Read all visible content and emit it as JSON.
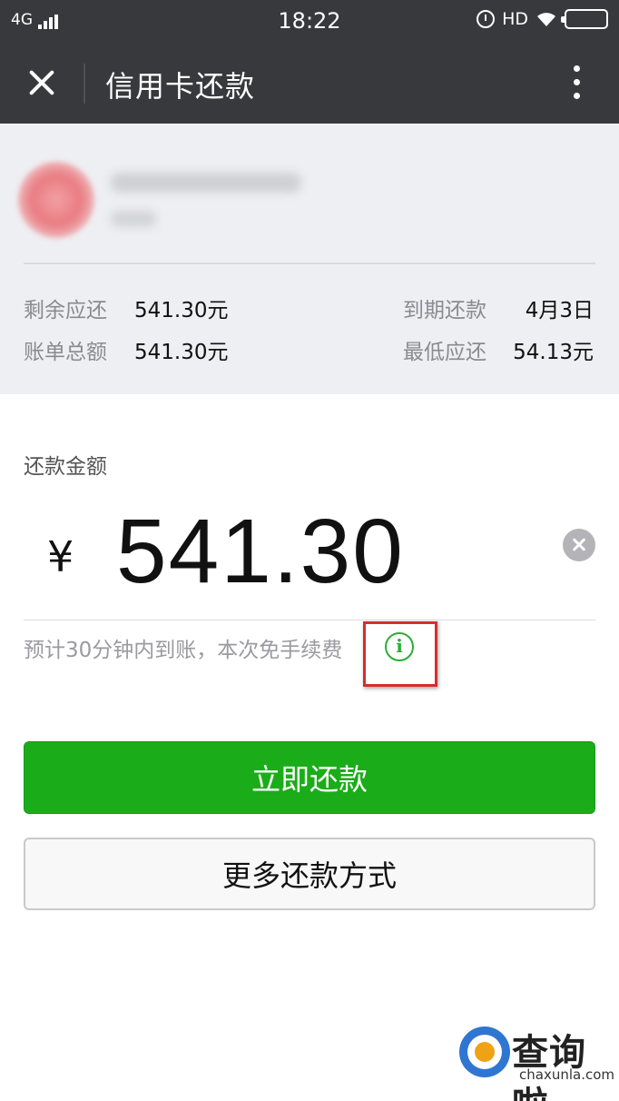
{
  "status_bar": {
    "network": "4G",
    "time": "18:22",
    "hd": "HD"
  },
  "nav": {
    "title": "信用卡还款"
  },
  "summary": {
    "remaining_label": "剩余应还",
    "remaining_value": "541.30元",
    "due_label": "到期还款",
    "due_value": "4月3日",
    "bill_total_label": "账单总额",
    "bill_total_value": "541.30元",
    "min_label": "最低应还",
    "min_value": "54.13元"
  },
  "payment": {
    "amount_label": "还款金额",
    "currency_symbol": "¥",
    "amount": "541.30",
    "hint": "预计30分钟内到账，本次免手续费",
    "info_glyph": "i",
    "pay_button": "立即还款",
    "more_ways_button": "更多还款方式"
  },
  "watermark": {
    "title": "查询啦",
    "subtitle": "chaxunla.com"
  },
  "colors": {
    "header_bg": "#37393d",
    "summary_bg": "#eeeff3",
    "primary_green": "#1aad19",
    "highlight_red": "#d62d2d"
  },
  "icons": [
    "signal-icon",
    "alarm-icon",
    "wifi-icon",
    "battery-icon",
    "close-icon",
    "more-icon",
    "clear-icon",
    "info-icon"
  ]
}
